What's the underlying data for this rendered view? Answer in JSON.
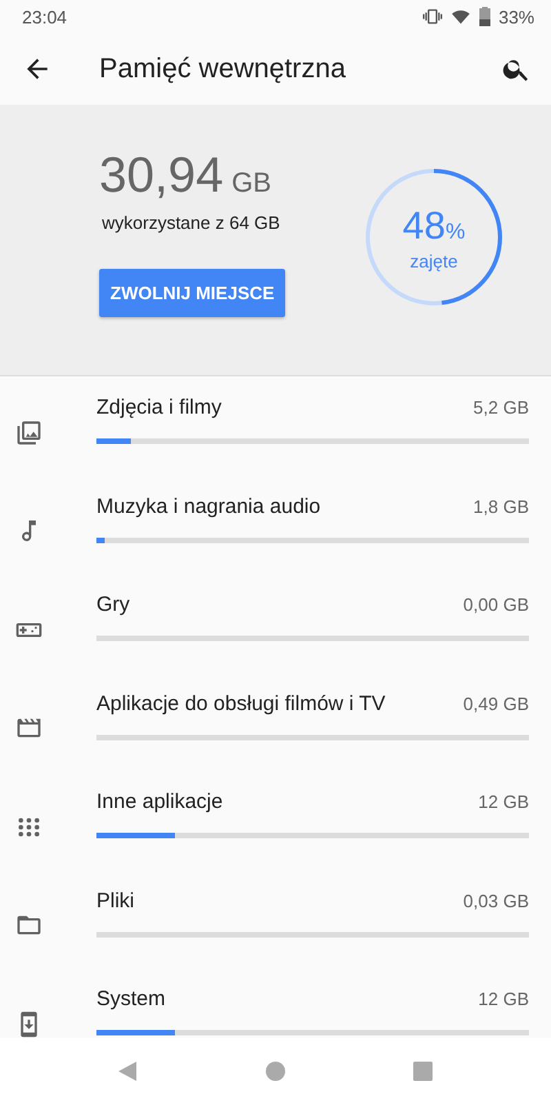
{
  "status_bar": {
    "time": "23:04",
    "battery": "33%"
  },
  "app_bar": {
    "title": "Pamięć wewnętrzna"
  },
  "summary": {
    "used": "30,94",
    "unit": "GB",
    "caption": "wykorzystane z 64 GB",
    "button": "ZWOLNIJ MIEJSCE",
    "percent": "48",
    "percent_sign": "%",
    "percent_caption": "zajęte"
  },
  "categories": [
    {
      "kind": "photos",
      "label": "Zdjęcia i filmy",
      "size": "5,2 GB",
      "level": 0.08
    },
    {
      "kind": "music",
      "label": "Muzyka i nagrania audio",
      "size": "1,8 GB",
      "level": 0.02
    },
    {
      "kind": "games",
      "label": "Gry",
      "size": "0,00 GB",
      "level": 0
    },
    {
      "kind": "movies",
      "label": "Aplikacje do obsługi filmów i TV",
      "size": "0,49 GB",
      "level": 0
    },
    {
      "kind": "apps",
      "label": "Inne aplikacje",
      "size": "12 GB",
      "level": 0.18
    },
    {
      "kind": "files",
      "label": "Pliki",
      "size": "0,03 GB",
      "level": 0
    },
    {
      "kind": "system",
      "label": "System",
      "size": "12 GB",
      "level": 0.18
    }
  ]
}
